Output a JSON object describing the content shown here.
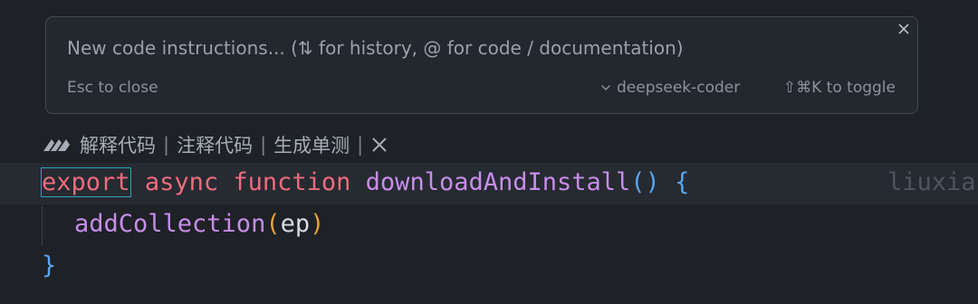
{
  "prompt": {
    "placeholder": "New code instructions... (⇅ for history, @ for code / documentation)",
    "esc_hint": "Esc to close",
    "model": "deepseek-coder",
    "toggle_hint": "⇧⌘K to toggle"
  },
  "codelens": {
    "explain": "解释代码",
    "comment": "注释代码",
    "unit_test": "生成单测",
    "separator": "|"
  },
  "code": {
    "line1": {
      "export": "export",
      "async": "async",
      "function": "function",
      "name": "downloadAndInstall",
      "parens": "()",
      "brace_open": "{",
      "blame": "liuxia"
    },
    "line2": {
      "call": "addCollection",
      "lparen": "(",
      "arg": "ep",
      "rparen": ")"
    },
    "line3": {
      "brace_close": "}"
    }
  },
  "colors": {
    "keyword": "#ee6b7d",
    "function_name": "#c78dea",
    "paren": "#e5a23d",
    "brace": "#59a4f0",
    "background": "#1e2126"
  }
}
